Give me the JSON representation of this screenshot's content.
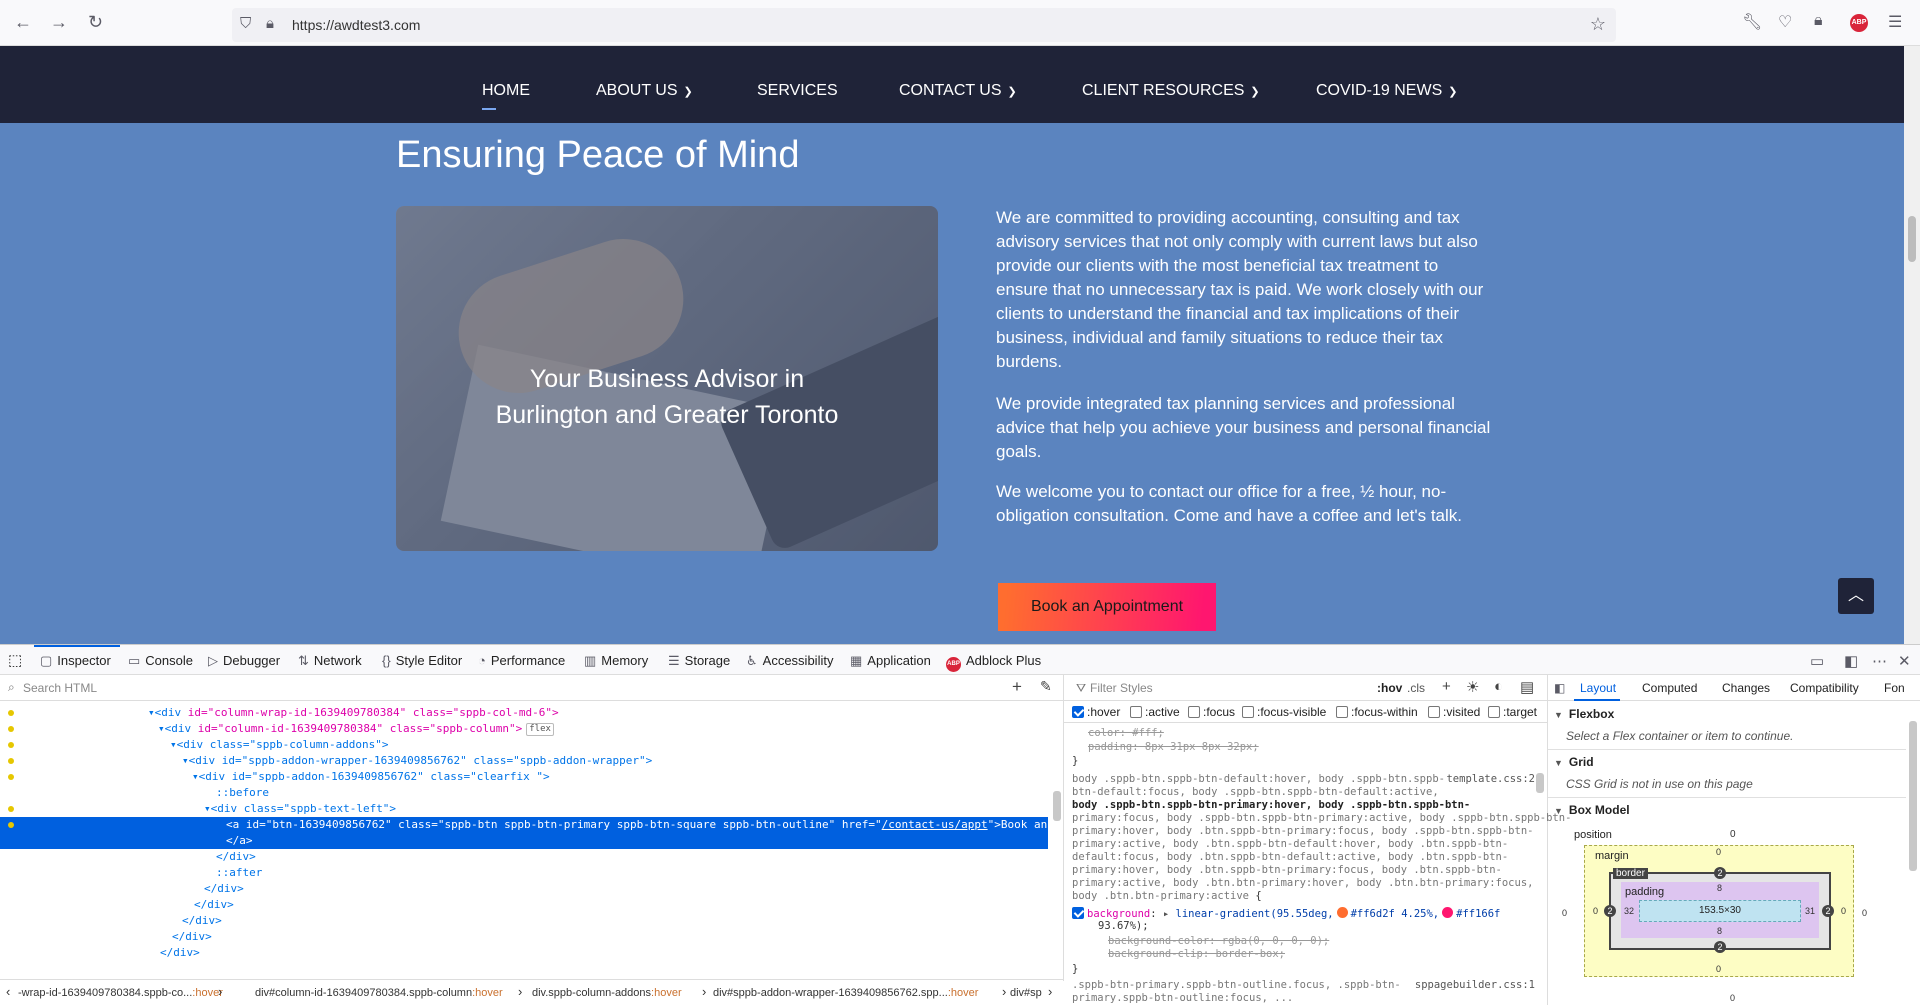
{
  "browser": {
    "url": "https://awdtest3.com"
  },
  "site": {
    "nav": [
      {
        "label": "HOME",
        "dropdown": false
      },
      {
        "label": "ABOUT US",
        "dropdown": true
      },
      {
        "label": "SERVICES",
        "dropdown": false
      },
      {
        "label": "CONTACT US",
        "dropdown": true
      },
      {
        "label": "CLIENT RESOURCES",
        "dropdown": true
      },
      {
        "label": "COVID-19 NEWS",
        "dropdown": true
      }
    ],
    "hero_title": "Ensuring Peace of Mind",
    "hero_caption_line1": "Your Business Advisor in",
    "hero_caption_line2": "Burlington and Greater Toronto",
    "paragraphs": [
      "We are committed to providing accounting, consulting and tax advisory services that not only comply with current laws but also provide our clients with the most beneficial tax treatment to ensure that no unnecessary tax is paid. We work closely with our clients to understand the financial and tax implications of their business, individual and family situations to reduce their tax burdens.",
      "We provide integrated tax planning services and professional advice that help you achieve your business and personal financial goals.",
      "We welcome you to contact our office for a free, ½ hour, no-obligation consultation. Come and have a coffee and let's talk."
    ],
    "cta_label": "Book an Appointment"
  },
  "devtools": {
    "tabs": [
      {
        "label": "Inspector",
        "icon": "inspector-icon"
      },
      {
        "label": "Console",
        "icon": "console-icon"
      },
      {
        "label": "Debugger",
        "icon": "debugger-icon"
      },
      {
        "label": "Network",
        "icon": "network-icon"
      },
      {
        "label": "Style Editor",
        "icon": "style-editor-icon"
      },
      {
        "label": "Performance",
        "icon": "performance-icon"
      },
      {
        "label": "Memory",
        "icon": "memory-icon"
      },
      {
        "label": "Storage",
        "icon": "storage-icon"
      },
      {
        "label": "Accessibility",
        "icon": "accessibility-icon"
      },
      {
        "label": "Application",
        "icon": "application-icon"
      },
      {
        "label": "Adblock Plus",
        "icon": "adblock-icon"
      }
    ],
    "search_placeholder": "Search HTML",
    "tree": {
      "l1_tag": "<div ",
      "l1_id": "id=\"column-wrap-id-1639409780384\"",
      "l1_class": " class=\"sppb-col-md-6\">",
      "l2_tag": "<div ",
      "l2_id": "id=\"column-id-1639409780384\"",
      "l2_class": " class=\"sppb-column\">",
      "l2_badge": "flex",
      "l3": "<div class=\"sppb-column-addons\">",
      "l4": "<div id=\"sppb-addon-wrapper-1639409856762\" class=\"sppb-addon-wrapper\">",
      "l5": "<div id=\"sppb-addon-1639409856762\" class=\"clearfix \">",
      "l6": "::before",
      "l7": "<div class=\"sppb-text-left\">",
      "l8_pre": "<a id=\"btn-1639409856762\" class=\"sppb-btn sppb-btn-primary sppb-btn-square sppb-btn-outline\" href=\"",
      "l8_href": "/contact-us/appt",
      "l8_post": "\">Book an Appointment",
      "l9": "</a>",
      "l10": "</div>",
      "l11": "::after",
      "l12": "</div>",
      "l13": "</div>",
      "l14": "</div>",
      "l15": "</div>",
      "l16": "</div>"
    },
    "breadcrumb": [
      {
        "text": "-wrap-id-1639409780384.sppb-co...",
        "state": ":hover"
      },
      {
        "text": "div#column-id-1639409780384.sppb-column",
        "state": ":hover"
      },
      {
        "text": "div.sppb-column-addons",
        "state": ":hover"
      },
      {
        "text": "div#sppb-addon-wrapper-1639409856762.spp...",
        "state": ":hover"
      },
      {
        "text": "div#sp",
        "state": ""
      }
    ],
    "rules": {
      "filter_placeholder": "Filter Styles",
      "hov": ":hov",
      "cls": ".cls",
      "pseudo": [
        {
          "label": ":hover",
          "checked": true
        },
        {
          "label": ":active",
          "checked": false
        },
        {
          "label": ":focus",
          "checked": false
        },
        {
          "label": ":focus-visible",
          "checked": false
        },
        {
          "label": ":focus-within",
          "checked": false
        },
        {
          "label": ":visited",
          "checked": false
        },
        {
          "label": ":target",
          "checked": false
        }
      ],
      "r1": "color: #fff;",
      "r2": "padding: 8px 31px 8px 32px;",
      "r3": "}",
      "r4": "body .sppb-btn.sppb-btn-default:hover, body .sppb-btn.sppb-",
      "r4_src": "template.css:2",
      "r5": "btn-default:focus, body .sppb-btn.sppb-btn-default:active,",
      "r6": "body .sppb-btn.sppb-btn-primary:hover, body .sppb-btn.sppb-btn-",
      "r7": "primary:focus, body .sppb-btn.sppb-btn-primary:active, body .sppb-btn.sppb-btn-",
      "r8": "primary:hover, body .btn.sppb-btn-primary:focus, body .sppb-btn.sppb-btn-",
      "r9": "primary:active, body .btn.sppb-btn-default:hover, body .btn.sppb-btn-",
      "r10": "default:focus, body .btn.sppb-btn-default:active, body .btn.sppb-btn-",
      "r11": "primary:hover, body .btn.sppb-btn-primary:focus, body .btn.sppb-btn-",
      "r12": "primary:active, body .btn.btn-primary:hover, body .btn.btn-primary:focus,",
      "r13": "body .btn.btn-primary:active",
      "r13b": " {",
      "bg_prop": "background",
      "bg_fn": "linear-gradient(",
      "bg_deg": "95.55deg,",
      "bg_c1": "#ff6d2f",
      "bg_p1": "4.25%,",
      "bg_c2": "#ff166f",
      "bg_p2": "93.67%);",
      "bg_color": "background-color: rgba(0, 0, 0, 0);",
      "bg_clip": "background-clip: border-box;",
      "r_close": "}",
      "r_next": ".sppb-btn-primary.sppb-btn-outline.focus, .sppb-btn-",
      "r_next_src": "sppagebuilder.css:1",
      "r_next2": "primary.sppb-btn-outline:focus, ..."
    },
    "side": {
      "tabs": [
        "Layout",
        "Computed",
        "Changes",
        "Compatibility",
        "Fon"
      ],
      "flexbox_title": "Flexbox",
      "flexbox_msg": "Select a Flex container or item to continue.",
      "grid_title": "Grid",
      "grid_msg": "CSS Grid is not in use on this page",
      "boxmodel_title": "Box Model",
      "position_label": "position",
      "position_val": "0",
      "margin_label": "margin",
      "border_label": "border",
      "padding_label": "padding",
      "content": "153.5×30",
      "margin_top": "0",
      "margin_left": "0",
      "margin_right": "0",
      "margin_bottom": "0",
      "border_top": "2",
      "border_left": "2",
      "border_right": "2",
      "border_bottom": "2",
      "padding_top": "8",
      "padding_left": "32",
      "padding_right": "31",
      "padding_bottom": "8",
      "pos_left": "0",
      "pos_right": "0",
      "pos_bottom": "0"
    }
  }
}
